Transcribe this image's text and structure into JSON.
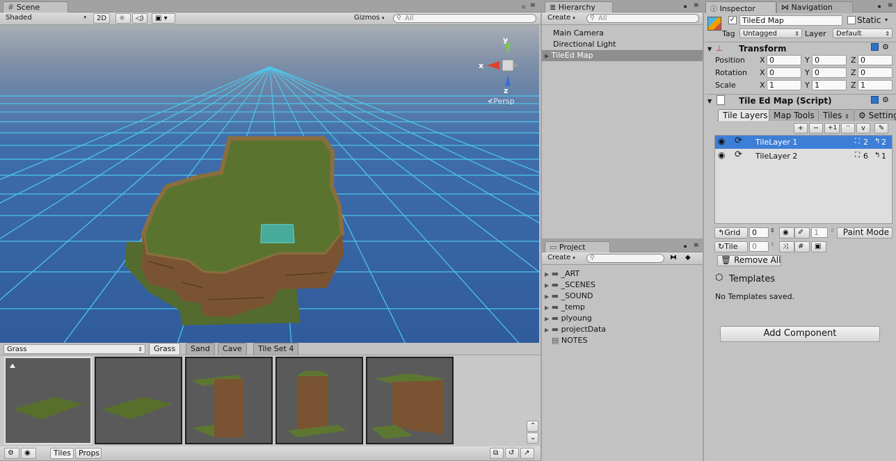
{
  "scene": {
    "tab_title": "Scene",
    "shading": "Shaded",
    "mode_2d": "2D",
    "gizmos": "Gizmos",
    "search_placeholder": "All",
    "axis_x": "x",
    "axis_y": "y",
    "axis_z": "z",
    "persp": "Persp"
  },
  "tile_palette": {
    "tileset_select": "Grass",
    "tabs": [
      "Grass",
      "Sand",
      "Cave",
      "Tile Set 4"
    ],
    "bottom_tabs": [
      "Tiles",
      "Props"
    ]
  },
  "hierarchy": {
    "tab_title": "Hierarchy",
    "create_label": "Create",
    "search_placeholder": "All",
    "items": [
      "Main Camera",
      "Directional Light",
      "TileEd Map"
    ]
  },
  "project": {
    "tab_title": "Project",
    "create_label": "Create",
    "items": [
      "_ART",
      "_SCENES",
      "_SOUND",
      "_temp",
      "plyoung",
      "projectData",
      "NOTES"
    ]
  },
  "inspector": {
    "tabs": [
      "Inspector",
      "Navigation"
    ],
    "object_name": "TileEd Map",
    "static_label": "Static",
    "tag_label": "Tag",
    "tag_value": "Untagged",
    "layer_label": "Layer",
    "layer_value": "Default",
    "transform": {
      "title": "Transform",
      "rows": [
        {
          "label": "Position",
          "x": "0",
          "y": "0",
          "z": "0"
        },
        {
          "label": "Rotation",
          "x": "0",
          "y": "0",
          "z": "0"
        },
        {
          "label": "Scale",
          "x": "1",
          "y": "1",
          "z": "1"
        }
      ]
    },
    "script": {
      "title": "Tile Ed Map (Script)",
      "tabs": [
        "Tile Layers",
        "Map Tools",
        "Tiles",
        "Settings"
      ],
      "layer_tools": [
        "+",
        "−",
        "+1",
        "^",
        "v"
      ],
      "layers": [
        {
          "name": "TileLayer 1",
          "count_a": "2",
          "count_b": "2",
          "selected": true
        },
        {
          "name": "TileLayer 2",
          "count_a": "6",
          "count_b": "1",
          "selected": false
        }
      ],
      "grid_label": "Grid",
      "grid_value": "0",
      "brush_value": "1",
      "paint_mode": "Paint Mode",
      "tile_label": "Tile",
      "tile_value": "0",
      "remove_all": "Remove All",
      "templates_title": "Templates",
      "templates_empty": "No Templates saved."
    },
    "add_component": "Add Component"
  },
  "colors": {
    "scene_sky": "#3565a8",
    "grid_line": "#4ec9ee",
    "selection": "#3d7fd6",
    "hierarchy_selected": "#8e8e8e"
  }
}
